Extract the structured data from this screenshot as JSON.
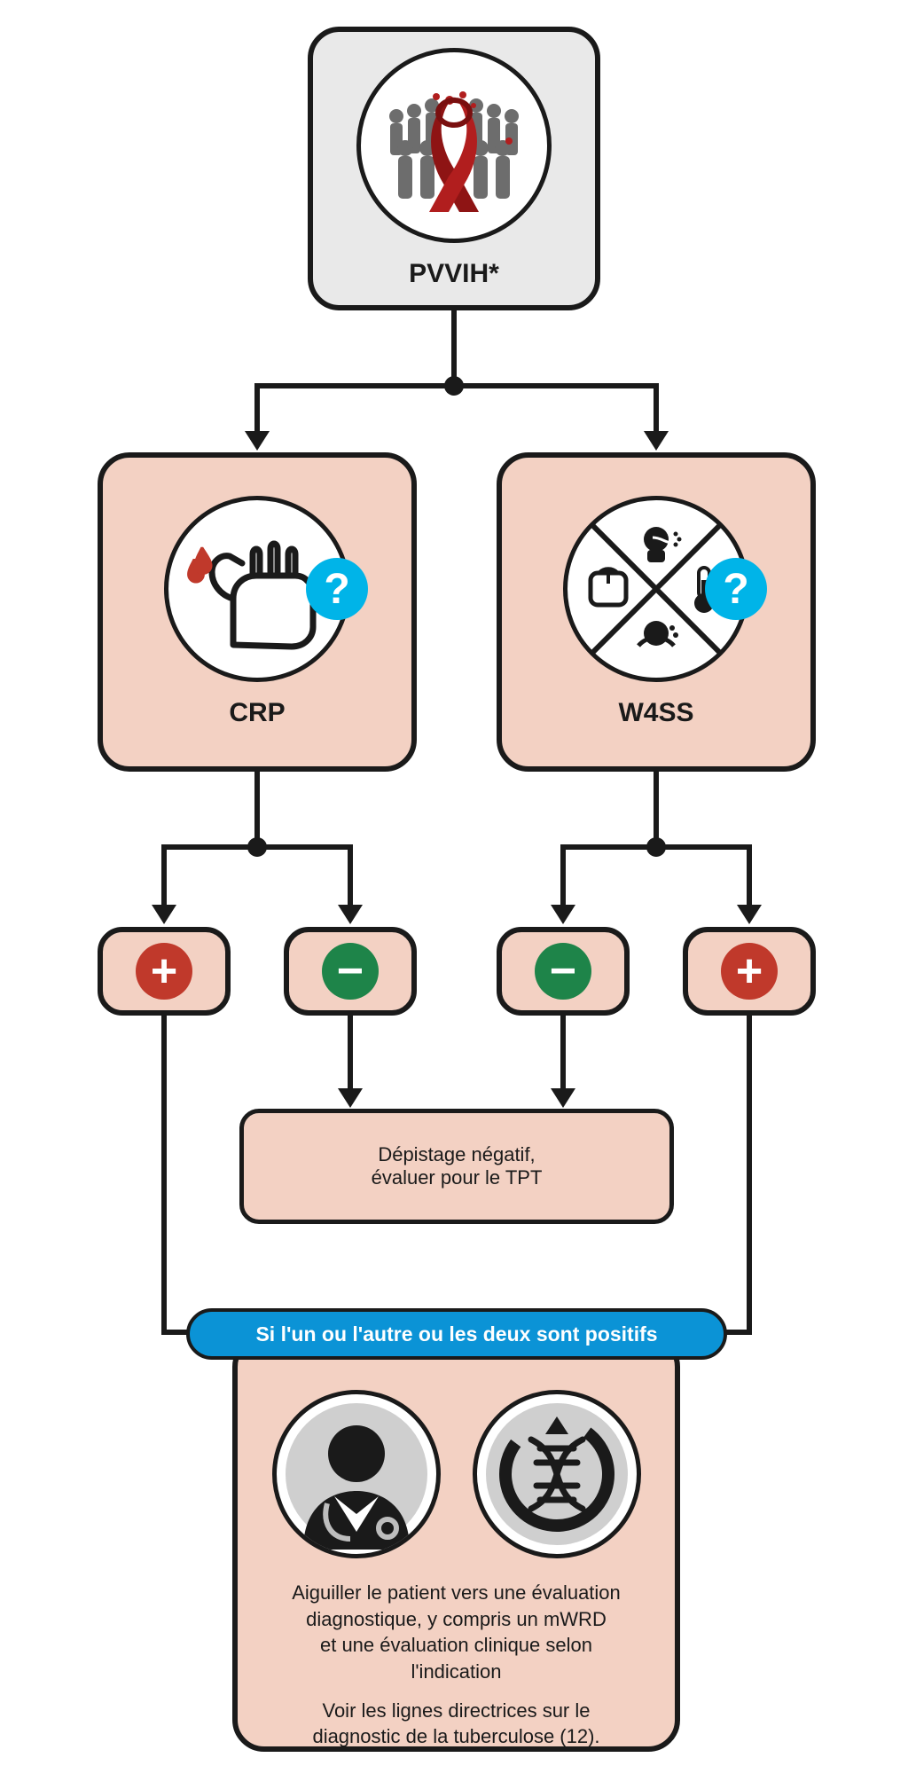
{
  "start": {
    "label": "PVVIH*"
  },
  "screens": {
    "crp": {
      "label": "CRP",
      "help": "?"
    },
    "w4ss": {
      "label": "W4SS",
      "help": "?"
    }
  },
  "results": {
    "positive_sign": "+",
    "negative_sign": "−"
  },
  "negative_outcome": {
    "line1": "Dépistage négatif,",
    "line2": "évaluer pour le TPT"
  },
  "banner": "Si l'un ou l'autre ou les deux sont positifs",
  "final": {
    "line1": "Aiguiller le patient vers une évaluation",
    "line2": "diagnostique, y compris un mWRD",
    "line3": "et une évaluation clinique selon",
    "line4": "l'indication",
    "sub1": "Voir les lignes directrices sur le",
    "sub2": "diagnostic de la tuberculose (12)."
  },
  "icons": {
    "start": "hiv-ribbon-people-icon",
    "crp": "finger-prick-blood-icon",
    "w4ss": "four-symptom-screen-icon",
    "doctor": "clinician-icon",
    "dna": "dna-helix-icon"
  }
}
